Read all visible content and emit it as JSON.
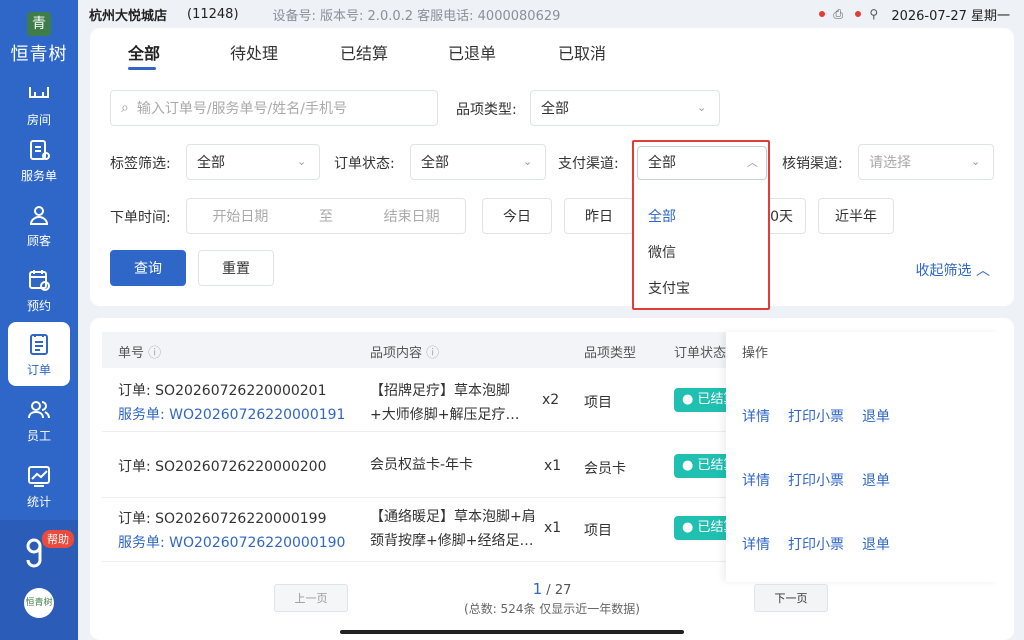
{
  "status_bar": {
    "store": "杭州大悦城店",
    "store_code": "(11248)",
    "device_info": "设备号: 版本号: 2.0.0.2 客服电话: 4000080629",
    "datetime": "2026-07-27 星期一"
  },
  "sidebar": {
    "brand": "恒青树",
    "logo_char": "青",
    "items": [
      {
        "label": "房间",
        "icon": "room-icon"
      },
      {
        "label": "服务单",
        "icon": "service-order-icon"
      },
      {
        "label": "顾客",
        "icon": "customer-icon"
      },
      {
        "label": "预约",
        "icon": "appointment-icon"
      },
      {
        "label": "订单",
        "icon": "order-icon"
      },
      {
        "label": "员工",
        "icon": "staff-icon"
      },
      {
        "label": "统计",
        "icon": "stats-icon"
      }
    ],
    "help_badge": "帮助",
    "avatar_text": "恒青树"
  },
  "tabs": [
    "全部",
    "待处理",
    "已结算",
    "已退单",
    "已取消"
  ],
  "filters": {
    "search_placeholder": "输入订单号/服务单号/姓名/手机号",
    "item_type_label": "品项类型:",
    "item_type_value": "全部",
    "tag_label": "标签筛选:",
    "tag_value": "全部",
    "order_status_label": "订单状态:",
    "order_status_value": "全部",
    "pay_channel_label": "支付渠道:",
    "pay_channel_value": "全部",
    "verify_channel_label": "核销渠道:",
    "verify_channel_placeholder": "请选择",
    "time_label": "下单时间:",
    "start_placeholder": "开始日期",
    "to": "至",
    "end_placeholder": "结束日期",
    "today": "今日",
    "yesterday": "昨日",
    "days30_partial": "0天",
    "half_year": "近半年",
    "query": "查询",
    "reset": "重置",
    "collapse": "收起筛选"
  },
  "dropdown": {
    "options": [
      "全部",
      "微信",
      "支付宝"
    ]
  },
  "table": {
    "headers": [
      "单号",
      "品项内容",
      "品项类型",
      "订单状态",
      "操作"
    ],
    "rows": [
      {
        "order": "订单: SO20260726220000201",
        "service": "服务单: WO20260726220000191",
        "content1": "【招牌足疗】草本泡脚",
        "content2": "+大师修脚+解压足疗…",
        "qty": "x2",
        "type": "项目",
        "status": "● 已结算"
      },
      {
        "order": "订单: SO20260726220000200",
        "service": "",
        "content1": "会员权益卡-年卡",
        "content2": "",
        "qty": "x1",
        "type": "会员卡",
        "status": "● 已结算"
      },
      {
        "order": "订单: SO20260726220000199",
        "service": "服务单: WO20260726220000190",
        "content1": "【通络暖足】草本泡脚+肩",
        "content2": "颈背按摩+修脚+经络足…",
        "qty": "x1",
        "type": "项目",
        "status": "● 已结算"
      }
    ],
    "actions": [
      "详情",
      "打印小票",
      "退单"
    ]
  },
  "pager": {
    "prev": "上一页",
    "current": "1",
    "sep": "/",
    "total_pages": "27",
    "summary": "(总数: 524条 仅显示近一年数据)",
    "next": "下一页"
  }
}
